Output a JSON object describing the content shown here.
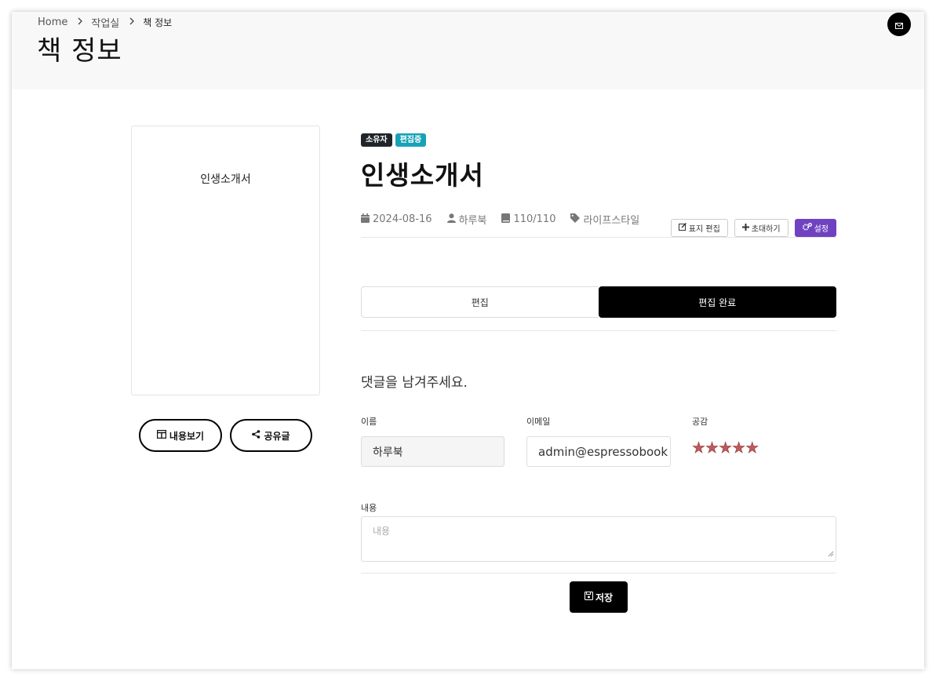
{
  "breadcrumb": {
    "home": "Home",
    "workroom": "작업실",
    "current": "책 정보"
  },
  "page_title": "책 정보",
  "cover": {
    "title": "인생소개서"
  },
  "cover_actions": {
    "view_label": "내용보기",
    "share_label": "공유글"
  },
  "book": {
    "badges": {
      "owner": "소유자",
      "editing": "편집중"
    },
    "title": "인생소개서",
    "meta": {
      "date": "2024-08-16",
      "author": "하루북",
      "pages": "110/110",
      "category": "라이프스타일"
    },
    "actions": {
      "cover_edit": "표지 편집",
      "invite": "초대하기",
      "settings": "설정"
    }
  },
  "tabs": {
    "edit": "편집",
    "done": "편집 완료"
  },
  "comment_form": {
    "heading": "댓글을 남겨주세요.",
    "name_label": "이름",
    "name_value": "하루북",
    "email_label": "이메일",
    "email_value": "admin@espressobook",
    "rating_label": "공감",
    "rating_value": 5,
    "rating_max": 5,
    "content_label": "내용",
    "content_placeholder": "내용",
    "save_label": "저장"
  },
  "colors": {
    "owner_badge": "#212529",
    "editing_badge": "#17a2b8",
    "settings_button": "#6f42c1",
    "star": "#c0595b"
  }
}
